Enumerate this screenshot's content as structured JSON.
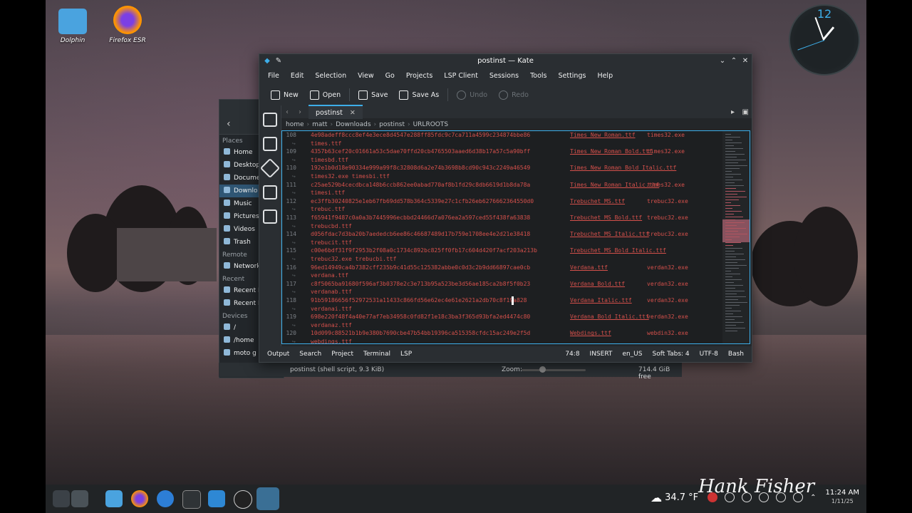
{
  "desktop_icons": [
    {
      "label": "Dolphin"
    },
    {
      "label": "Firefox ESR"
    }
  ],
  "clock": {
    "hour_label": "12"
  },
  "dolphin": {
    "sections": [
      {
        "title": "Places",
        "items": [
          "Home",
          "Desktop",
          "Docume",
          "Downlo",
          "Music",
          "Pictures",
          "Videos",
          "Trash"
        ]
      },
      {
        "title": "Remote",
        "items": [
          "Network"
        ]
      },
      {
        "title": "Recent",
        "items": [
          "Recent F",
          "Recent L"
        ]
      },
      {
        "title": "Devices",
        "items": [
          "/",
          "/home",
          "moto g power ..."
        ]
      }
    ],
    "status": "postinst (shell script, 9.3 KiB)",
    "zoom_label": "Zoom:",
    "free_space": "714.4 GiB free"
  },
  "kate": {
    "title": "postinst — Kate",
    "menu": [
      "File",
      "Edit",
      "Selection",
      "View",
      "Go",
      "Projects",
      "LSP Client",
      "Sessions",
      "Tools",
      "Settings",
      "Help"
    ],
    "toolbar": {
      "new": "New",
      "open": "Open",
      "save": "Save",
      "save_as": "Save As",
      "undo": "Undo",
      "redo": "Redo"
    },
    "tab": "postinst",
    "breadcrumb": [
      "home",
      "matt",
      "Downloads",
      "postinst",
      "URLROOTS"
    ],
    "lines": [
      {
        "n": "108",
        "hash": "4e98adeff8ccc8ef4e3ece8d4547e288ff85fdc9c7ca711a4599c234874bbe86",
        "file": "Times_New_Roman.ttf",
        "exe": "times32.exe",
        "wrap": "times.ttf"
      },
      {
        "n": "109",
        "hash": "4357b63cef20c01661a53c5dae70ffd20cb4765503aaed6d38b17a57c5a90bff",
        "file": "Times_New_Roman_Bold.ttf",
        "exe": "times32.exe",
        "wrap": "timesbd.ttf"
      },
      {
        "n": "110",
        "hash": "192e1b0d18e90334e999a99f8c32808d6a2e74b3698b8cd90c943c2249a46549",
        "file": "Times_New_Roman_Bold_Italic.ttf",
        "exe": "",
        "wrap": "times32.exe timesbi.ttf"
      },
      {
        "n": "111",
        "hash": "c25ae529b4cecdbca148b6ccb862ee0abad770af8b1fd29c8db6619d1b8da78a",
        "file": "Times_New_Roman_Italic.ttf",
        "exe": "times32.exe",
        "wrap": "timesi.ttf"
      },
      {
        "n": "112",
        "hash": "ec3ffb30240825e1eb67fb69dd578b364c5339e27c1cfb26eb6276662364550d0",
        "file": "Trebuchet_MS.ttf",
        "exe": "trebuc32.exe",
        "wrap": "trebuc.ttf"
      },
      {
        "n": "113",
        "hash": "f65941f9487c0a0a3b7445996ecbbd24466d7a076ea2a597ced55f438fa63838",
        "file": "Trebuchet_MS_Bold.ttf",
        "exe": "trebuc32.exe",
        "wrap": "trebucbd.ttf"
      },
      {
        "n": "114",
        "hash": "d056fdac7d3ba20b7aededcb6ee86c46687489d17b759e1708ee4e2d21e38418",
        "file": "Trebuchet_MS_Italic.ttf",
        "exe": "trebuc32.exe",
        "wrap": "trebucit.ttf"
      },
      {
        "n": "115",
        "hash": "c00e6bdf31f9f2953b2f08a0c1734c892bc825ff0fb17c604d420f7acf203a213b",
        "file": "Trebuchet_MS_Bold_Italic.ttf",
        "exe": "",
        "wrap": "trebuc32.exe    trebucbi.ttf"
      },
      {
        "n": "116",
        "hash": "96ed14949ca4b7382cff235b9c41d55c125382abbe0c0d3c2b9dd66897cae0cb",
        "file": "Verdana.ttf",
        "exe": "verdan32.exe",
        "wrap": "verdana.ttf"
      },
      {
        "n": "117",
        "hash": "c8f5065ba91680f596af3b0378e2c3e713b95a523be3d56ae185ca2b8f5f0b23",
        "file": "Verdana_Bold.ttf",
        "exe": "verdan32.exe",
        "wrap": "verdanab.ttf"
      },
      {
        "n": "118",
        "hash": "91b59186656f52972531a11433c866fd56e62ec4e61e2621a2db70c8f19a828",
        "file": "Verdana_Italic.ttf",
        "exe": "verdan32.exe",
        "wrap": "verdanai.ttf"
      },
      {
        "n": "119",
        "hash": "698e220f48f4a40e77af7eb34958c0fd82f1e18c3ba3f365d93bfa2ed4474c80",
        "file": "Verdana_Bold_Italic.ttf",
        "exe": "verdan32.exe",
        "wrap": "verdanaz.ttf"
      },
      {
        "n": "120",
        "hash": "10d099c88521b1b9e380b7690cbe47b54bb19396ca515358cfdc15ac249e2f5d",
        "file": "Webdings.ttf",
        "exe": "webdin32.exe",
        "wrap": "webdings.ttf"
      }
    ],
    "status_left": [
      "Output",
      "Search",
      "Project",
      "Terminal",
      "LSP"
    ],
    "status_right": [
      "74:8",
      "INSERT",
      "en_US",
      "Soft Tabs: 4",
      "UTF-8",
      "Bash"
    ]
  },
  "taskbar": {
    "temperature": "34.7 °F",
    "time": "11:24 AM",
    "date": "1/11/25"
  },
  "signature": "Hank Fisher"
}
